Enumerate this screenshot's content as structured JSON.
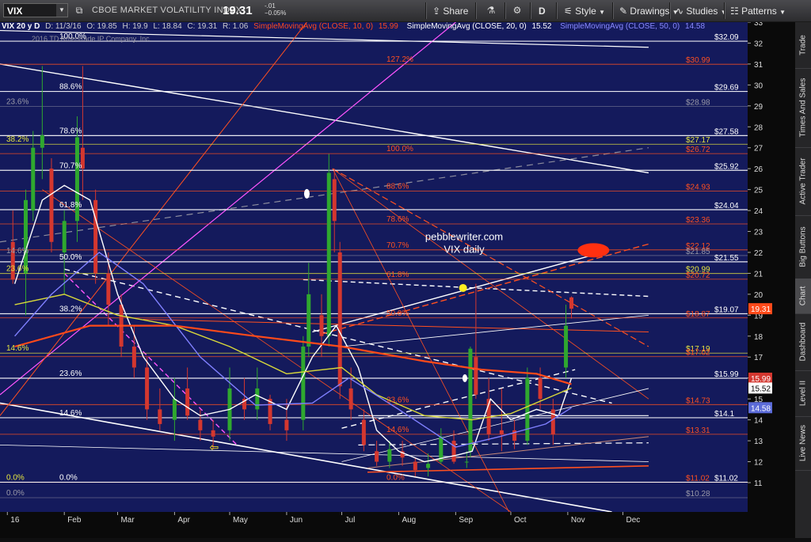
{
  "toolbar": {
    "symbol": "VIX",
    "description": "CBOE MARKET VOLATILITY INDEX",
    "last_price": "19.31",
    "change_abs": "-.01",
    "change_pct": "−0.05%",
    "share_label": "Share",
    "interval_label": "D",
    "style_label": "Style",
    "drawings_label": "Drawings",
    "studies_label": "Studies",
    "patterns_label": "Patterns"
  },
  "legend": {
    "ohlc": "VIX 20 y D",
    "date": "D: 11/3/16",
    "open": "O: 19.85",
    "high": "H: 19.9",
    "low": "L: 18.84",
    "close": "C: 19.31",
    "range": "R: 1.06",
    "sma10": "SimpleMovingAvg (CLOSE, 10, 0)",
    "sma10_val": "15.99",
    "sma20": "SimpleMovingAvg (CLOSE, 20, 0)",
    "sma20_val": "15.52",
    "sma50": "SimpleMovingAvg (CLOSE, 50, 0)",
    "sma50_val": "14.58",
    "copyright": "2016 TD Ameritrade IP Company, Inc."
  },
  "annotations": {
    "watermark_line1": "pebblewriter.com",
    "watermark_line2": "VIX daily"
  },
  "sidebar": {
    "items": [
      "Trade",
      "Times And Sales",
      "Active Trader",
      "Big Buttons",
      "Chart",
      "Dashboard",
      "Level II",
      "Live News"
    ],
    "active": "Chart"
  },
  "colors": {
    "background": "#141a5c",
    "candle_up": "#2fa82f",
    "candle_down": "#d4372f",
    "sma10": "#ffffff",
    "sma20": "#d8d83a",
    "sma50": "#8080ff",
    "sma200": "#ff4a1a",
    "fib_orange": "#ff5020",
    "fib_white": "#ffffff"
  },
  "chart_data": {
    "type": "candlestick",
    "symbol": "VIX",
    "period": "daily",
    "ylim": [
      9.6,
      33
    ],
    "y_ticks": [
      11,
      12,
      13,
      14,
      15,
      16,
      17,
      18,
      19,
      20,
      21,
      22,
      23,
      24,
      25,
      26,
      27,
      28,
      29,
      30,
      31,
      32,
      33
    ],
    "x_ticks": [
      "16",
      "Feb",
      "Mar",
      "Apr",
      "May",
      "Jun",
      "Jul",
      "Aug",
      "Sep",
      "Oct",
      "Nov",
      "Dec"
    ],
    "x_tick_dates": [
      "2016-01-01",
      "2016-02-01",
      "2016-03-01",
      "2016-04-01",
      "2016-05-01",
      "2016-06-01",
      "2016-07-01",
      "2016-08-01",
      "2016-09-01",
      "2016-10-01",
      "2016-11-01",
      "2016-12-01"
    ],
    "price_labels": [
      {
        "value": 32.09,
        "text": "$32.09",
        "color": "white"
      },
      {
        "value": 30.99,
        "text": "$30.99",
        "color": "orange"
      },
      {
        "value": 29.69,
        "text": "$29.69",
        "color": "white"
      },
      {
        "value": 28.98,
        "text": "$28.98",
        "color": "grey"
      },
      {
        "value": 27.58,
        "text": "$27.58",
        "color": "white"
      },
      {
        "value": 27.17,
        "text": "$27.17",
        "color": "yellow"
      },
      {
        "value": 26.72,
        "text": "$26.72",
        "color": "orange"
      },
      {
        "value": 25.92,
        "text": "$25.92",
        "color": "white"
      },
      {
        "value": 24.93,
        "text": "$24.93",
        "color": "orange"
      },
      {
        "value": 24.04,
        "text": "$24.04",
        "color": "white"
      },
      {
        "value": 23.36,
        "text": "$23.36",
        "color": "orange"
      },
      {
        "value": 22.12,
        "text": "$22.12",
        "color": "orange"
      },
      {
        "value": 21.85,
        "text": "$21.85",
        "color": "grey"
      },
      {
        "value": 21.55,
        "text": "$21.55",
        "color": "white"
      },
      {
        "value": 20.99,
        "text": "$20.99",
        "color": "yellow"
      },
      {
        "value": 20.72,
        "text": "$20.72",
        "color": "orange"
      },
      {
        "value": 19.07,
        "text": "$19.07",
        "color": "white"
      },
      {
        "value": 18.87,
        "text": "$18.87",
        "color": "orange"
      },
      {
        "value": 17.19,
        "text": "$17.19",
        "color": "yellow"
      },
      {
        "value": 17.02,
        "text": "$17.02",
        "color": "orange"
      },
      {
        "value": 15.99,
        "text": "$15.99",
        "color": "white"
      },
      {
        "value": 14.73,
        "text": "$14.73",
        "color": "orange"
      },
      {
        "value": 14.1,
        "text": "$14.1",
        "color": "white"
      },
      {
        "value": 13.31,
        "text": "$13.31",
        "color": "orange"
      },
      {
        "value": 11.02,
        "text": "$11.02",
        "color": "orange"
      },
      {
        "value": 11.02,
        "text": "$11.02",
        "color": "white"
      },
      {
        "value": 10.28,
        "text": "$10.28",
        "color": "grey"
      }
    ],
    "axis_boxes": [
      {
        "value": 19.31,
        "text": "19.31",
        "color": "#ff4a1a"
      },
      {
        "value": 15.99,
        "text": "15.99",
        "color": "#d4372f"
      },
      {
        "value": 15.52,
        "text": "15.52",
        "color": "#ffffff"
      },
      {
        "value": 14.58,
        "text": "14.58",
        "color": "#5b6bd8"
      }
    ],
    "fib_left": [
      {
        "value": 32.09,
        "text": "100.0%",
        "color": "white"
      },
      {
        "value": 29.69,
        "text": "88.6%",
        "color": "white"
      },
      {
        "value": 27.58,
        "text": "78.6%",
        "color": "white"
      },
      {
        "value": 25.92,
        "text": "70.7%",
        "color": "white"
      },
      {
        "value": 24.04,
        "text": "61.8%",
        "color": "white"
      },
      {
        "value": 21.55,
        "text": "50.0%",
        "color": "white"
      },
      {
        "value": 19.07,
        "text": "38.2%",
        "color": "white"
      },
      {
        "value": 15.99,
        "text": "23.6%",
        "color": "white"
      },
      {
        "value": 14.1,
        "text": "14.6%",
        "color": "white"
      },
      {
        "value": 11.02,
        "text": "0.0%",
        "color": "white"
      },
      {
        "value": 28.98,
        "text": "23.6%",
        "color": "grey"
      },
      {
        "value": 27.17,
        "text": "38.2%",
        "color": "yellow"
      },
      {
        "value": 21.85,
        "text": "14.6%",
        "color": "grey"
      },
      {
        "value": 20.99,
        "text": "23.6%",
        "color": "yellow"
      },
      {
        "value": 17.19,
        "text": "14.6%",
        "color": "yellow"
      },
      {
        "value": 11.02,
        "text": "0.0%",
        "color": "yellow"
      },
      {
        "value": 10.28,
        "text": "0.0%",
        "color": "grey"
      }
    ],
    "fib_mid": [
      {
        "value": 30.99,
        "text": "127.2%"
      },
      {
        "value": 26.72,
        "text": "100.0%"
      },
      {
        "value": 24.93,
        "text": "88.6%"
      },
      {
        "value": 23.36,
        "text": "78.6%"
      },
      {
        "value": 22.12,
        "text": "70.7%"
      },
      {
        "value": 20.72,
        "text": "61.8%"
      },
      {
        "value": 18.87,
        "text": "50.0%"
      },
      {
        "value": 14.73,
        "text": "23.6%"
      },
      {
        "value": 13.31,
        "text": "14.6%"
      },
      {
        "value": 11.02,
        "text": "0.0%"
      }
    ],
    "ohlc_points": [
      [
        "2016-01-04",
        22.5,
        24.0,
        20.5,
        20.7
      ],
      [
        "2016-01-11",
        21.0,
        25.0,
        19.0,
        24.5
      ],
      [
        "2016-01-15",
        24.0,
        27.8,
        23.5,
        27.0
      ],
      [
        "2016-01-20",
        27.0,
        30.9,
        25.5,
        27.6
      ],
      [
        "2016-01-25",
        26.0,
        26.5,
        22.0,
        22.5
      ],
      [
        "2016-02-01",
        22.0,
        24.0,
        20.0,
        23.5
      ],
      [
        "2016-02-08",
        23.5,
        28.5,
        22.5,
        27.5
      ],
      [
        "2016-02-11",
        27.0,
        30.9,
        24.5,
        26.0
      ],
      [
        "2016-02-18",
        24.5,
        25.0,
        20.5,
        21.0
      ],
      [
        "2016-02-25",
        21.0,
        22.0,
        18.5,
        19.5
      ],
      [
        "2016-03-03",
        19.5,
        20.0,
        17.0,
        17.5
      ],
      [
        "2016-03-10",
        17.5,
        18.5,
        16.0,
        16.5
      ],
      [
        "2016-03-17",
        16.5,
        17.0,
        14.0,
        14.5
      ],
      [
        "2016-03-24",
        14.5,
        15.5,
        13.5,
        13.8
      ],
      [
        "2016-04-01",
        14.0,
        16.0,
        13.0,
        15.0
      ],
      [
        "2016-04-08",
        15.5,
        16.5,
        14.0,
        14.2
      ],
      [
        "2016-04-15",
        14.0,
        14.5,
        13.0,
        13.5
      ],
      [
        "2016-04-22",
        13.5,
        14.0,
        12.6,
        13.2
      ],
      [
        "2016-05-01",
        13.5,
        16.5,
        13.0,
        15.5
      ],
      [
        "2016-05-09",
        15.0,
        16.0,
        14.0,
        14.5
      ],
      [
        "2016-05-16",
        14.5,
        16.5,
        14.0,
        15.5
      ],
      [
        "2016-05-23",
        15.0,
        15.2,
        13.5,
        13.8
      ],
      [
        "2016-06-01",
        14.0,
        15.0,
        13.0,
        13.5
      ],
      [
        "2016-06-10",
        14.0,
        18.0,
        13.5,
        17.5
      ],
      [
        "2016-06-13",
        17.5,
        21.5,
        17.0,
        20.0
      ],
      [
        "2016-06-20",
        19.0,
        20.0,
        17.0,
        18.0
      ],
      [
        "2016-06-24",
        18.0,
        26.7,
        17.5,
        25.8
      ],
      [
        "2016-06-27",
        25.5,
        26.0,
        22.0,
        23.5
      ],
      [
        "2016-06-30",
        22.0,
        22.5,
        15.0,
        15.6
      ],
      [
        "2016-07-06",
        15.5,
        16.5,
        14.0,
        14.5
      ],
      [
        "2016-07-13",
        14.0,
        14.5,
        12.5,
        12.8
      ],
      [
        "2016-07-20",
        12.5,
        13.0,
        11.8,
        12.0
      ],
      [
        "2016-07-27",
        12.0,
        13.0,
        11.7,
        12.6
      ],
      [
        "2016-08-03",
        12.5,
        13.0,
        11.8,
        12.2
      ],
      [
        "2016-08-10",
        12.0,
        12.2,
        11.3,
        11.6
      ],
      [
        "2016-08-17",
        11.7,
        12.4,
        11.3,
        11.9
      ],
      [
        "2016-08-24",
        12.0,
        13.6,
        11.9,
        13.2
      ],
      [
        "2016-08-31",
        13.0,
        13.5,
        11.9,
        12.0
      ],
      [
        "2016-09-07",
        12.0,
        12.5,
        11.7,
        12.0
      ],
      [
        "2016-09-09",
        12.5,
        17.5,
        12.2,
        17.4
      ],
      [
        "2016-09-12",
        17.0,
        20.5,
        15.0,
        15.2
      ],
      [
        "2016-09-19",
        15.0,
        16.0,
        13.0,
        13.3
      ],
      [
        "2016-09-26",
        13.5,
        15.5,
        12.5,
        13.3
      ],
      [
        "2016-10-03",
        13.5,
        14.0,
        12.6,
        13.0
      ],
      [
        "2016-10-10",
        13.0,
        16.5,
        12.8,
        16.0
      ],
      [
        "2016-10-17",
        16.0,
        16.5,
        14.5,
        15.0
      ],
      [
        "2016-10-24",
        14.5,
        15.0,
        12.8,
        13.3
      ],
      [
        "2016-10-31",
        16.5,
        19.5,
        16.0,
        18.5
      ],
      [
        "2016-11-03",
        19.85,
        19.9,
        18.84,
        19.31
      ]
    ],
    "series": [
      {
        "name": "SimpleMovingAvg (CLOSE, 10, 0)",
        "color": "#ffffff",
        "points": [
          [
            "2016-01-05",
            20.5
          ],
          [
            "2016-01-20",
            24.5
          ],
          [
            "2016-02-01",
            25.2
          ],
          [
            "2016-02-15",
            24.5
          ],
          [
            "2016-03-01",
            20.0
          ],
          [
            "2016-03-15",
            17.0
          ],
          [
            "2016-04-01",
            15.0
          ],
          [
            "2016-04-15",
            14.2
          ],
          [
            "2016-05-01",
            14.5
          ],
          [
            "2016-05-15",
            15.2
          ],
          [
            "2016-06-01",
            14.5
          ],
          [
            "2016-06-15",
            17.0
          ],
          [
            "2016-06-28",
            18.5
          ],
          [
            "2016-07-10",
            16.5
          ],
          [
            "2016-07-20",
            13.5
          ],
          [
            "2016-08-01",
            12.5
          ],
          [
            "2016-08-15",
            12.0
          ],
          [
            "2016-09-01",
            12.3
          ],
          [
            "2016-09-10",
            12.5
          ],
          [
            "2016-09-20",
            15.0
          ],
          [
            "2016-10-01",
            14.0
          ],
          [
            "2016-10-15",
            14.5
          ],
          [
            "2016-10-27",
            14.2
          ],
          [
            "2016-11-03",
            15.99
          ]
        ]
      },
      {
        "name": "SimpleMovingAvg (CLOSE, 20, 0)",
        "color": "#d8d83a",
        "points": [
          [
            "2016-01-05",
            19.5
          ],
          [
            "2016-02-01",
            20.0
          ],
          [
            "2016-03-01",
            19.0
          ],
          [
            "2016-04-01",
            18.5
          ],
          [
            "2016-05-01",
            17.5
          ],
          [
            "2016-06-01",
            16.2
          ],
          [
            "2016-07-01",
            16.5
          ],
          [
            "2016-07-20",
            15.2
          ],
          [
            "2016-08-15",
            14.2
          ],
          [
            "2016-09-10",
            14.0
          ],
          [
            "2016-10-01",
            14.3
          ],
          [
            "2016-11-03",
            15.52
          ]
        ]
      },
      {
        "name": "SimpleMovingAvg (CLOSE, 50, 0)",
        "color": "#8080ff",
        "points": [
          [
            "2016-01-05",
            18.0
          ],
          [
            "2016-01-25",
            20.0
          ],
          [
            "2016-02-20",
            22.0
          ],
          [
            "2016-03-15",
            20.5
          ],
          [
            "2016-04-15",
            17.0
          ],
          [
            "2016-05-15",
            14.7
          ],
          [
            "2016-06-15",
            14.8
          ],
          [
            "2016-07-05",
            16.0
          ],
          [
            "2016-08-01",
            14.5
          ],
          [
            "2016-09-01",
            12.7
          ],
          [
            "2016-09-25",
            13.2
          ],
          [
            "2016-10-20",
            13.8
          ],
          [
            "2016-11-03",
            14.58
          ]
        ]
      },
      {
        "name": "SimpleMovingAvg (CLOSE, 200, 0)",
        "color": "#ff4a1a",
        "points": [
          [
            "2016-01-05",
            17.5
          ],
          [
            "2016-02-15",
            18.5
          ],
          [
            "2016-04-01",
            18.5
          ],
          [
            "2016-05-15",
            18.0
          ],
          [
            "2016-07-01",
            17.5
          ],
          [
            "2016-08-15",
            16.8
          ],
          [
            "2016-09-15",
            16.4
          ],
          [
            "2016-10-15",
            16.2
          ],
          [
            "2016-11-03",
            15.7
          ]
        ]
      }
    ]
  }
}
